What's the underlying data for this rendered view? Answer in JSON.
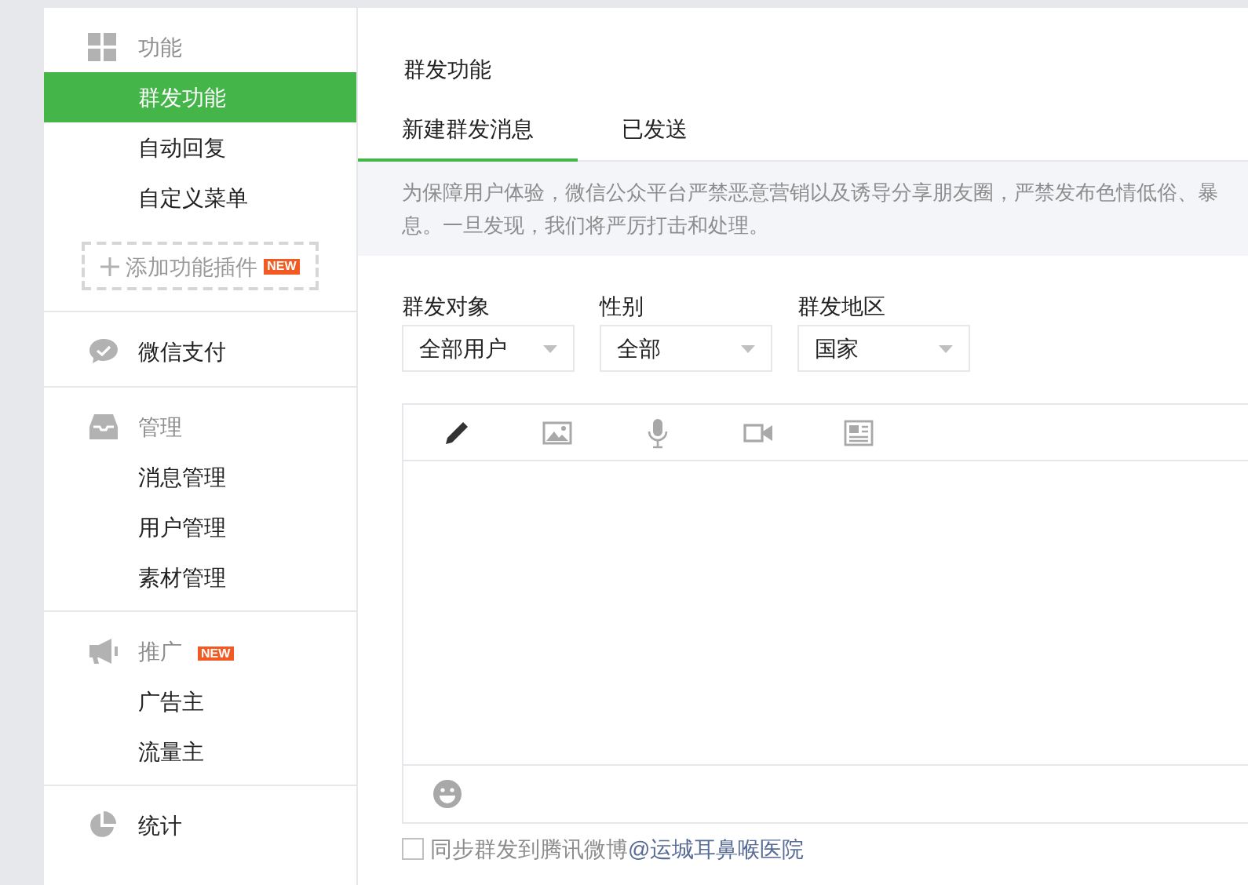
{
  "sidebar": {
    "sections": [
      {
        "title": "功能",
        "kind": "grid",
        "items": [
          {
            "label": "群发功能",
            "selected": true
          },
          {
            "label": "自动回复",
            "selected": false
          },
          {
            "label": "自定义菜单",
            "selected": false
          }
        ],
        "add_button": {
          "label": "添加功能插件",
          "badge": "NEW"
        }
      },
      {
        "title": "微信支付",
        "kind": "chat"
      },
      {
        "title": "管理",
        "kind": "inbox",
        "items": [
          {
            "label": "消息管理",
            "selected": false
          },
          {
            "label": "用户管理",
            "selected": false
          },
          {
            "label": "素材管理",
            "selected": false
          }
        ]
      },
      {
        "title": "推广",
        "kind": "megaphone",
        "badge": "NEW",
        "items": [
          {
            "label": "广告主",
            "selected": false
          },
          {
            "label": "流量主",
            "selected": false
          }
        ]
      },
      {
        "title": "统计",
        "kind": "pie"
      }
    ]
  },
  "main": {
    "title": "群发功能",
    "tabs": [
      {
        "label": "新建群发消息",
        "selected": true
      },
      {
        "label": "已发送",
        "selected": false
      }
    ],
    "notice_lines": [
      "为保障用户体验，微信公众平台严禁恶意营销以及诱导分享朋友圈，严禁发布色情低俗、暴",
      "息。一旦发现，我们将严厉打击和处理。"
    ],
    "filters": [
      {
        "label": "群发对象",
        "value": "全部用户"
      },
      {
        "label": "性别",
        "value": "全部"
      },
      {
        "label": "群发地区",
        "value": "国家"
      }
    ],
    "editor": {
      "tools": [
        {
          "kind": "text",
          "selected": true
        },
        {
          "kind": "image",
          "selected": false
        },
        {
          "kind": "voice",
          "selected": false
        },
        {
          "kind": "video",
          "selected": false
        },
        {
          "kind": "news",
          "selected": false
        }
      ]
    },
    "sync": {
      "checked": false,
      "label": "同步群发到腾讯微博",
      "link": "@运城耳鼻喉医院"
    }
  }
}
